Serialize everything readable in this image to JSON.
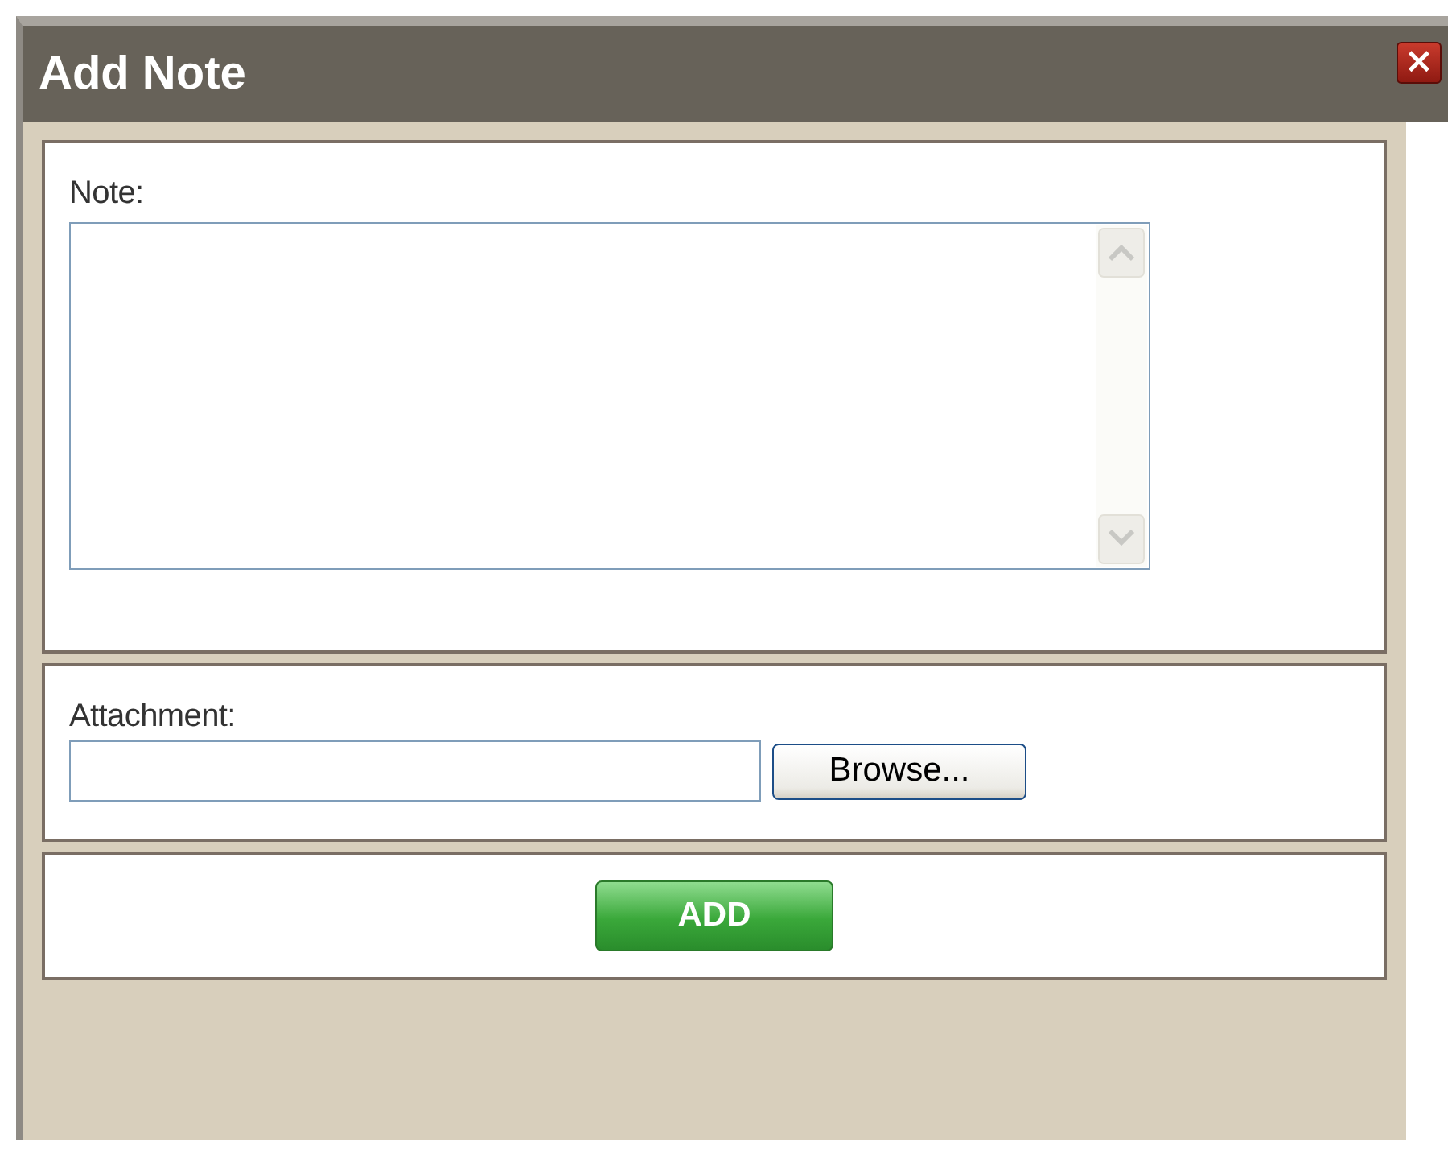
{
  "window": {
    "title": "Add Note",
    "close": "×"
  },
  "note": {
    "label": "Note:"
  },
  "attachment": {
    "label": "Attachment:",
    "browse": "Browse..."
  },
  "buttons": [
    "ADD"
  ]
}
